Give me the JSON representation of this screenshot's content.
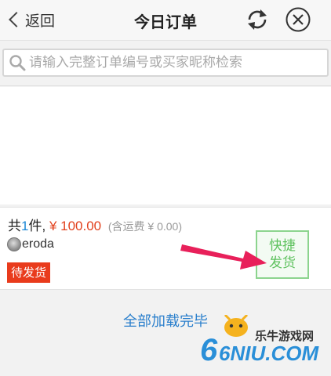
{
  "header": {
    "back_label": "返回",
    "title": "今日订单"
  },
  "icons": {
    "back": "chevron-left-icon",
    "refresh": "refresh-icon",
    "close": "close-circle-icon",
    "search": "search-icon",
    "next": "chevron-right-circle-icon"
  },
  "search": {
    "placeholder": "请输入完整订单编号或买家昵称检索",
    "value": ""
  },
  "order": {
    "prefix": "共",
    "quantity": "1",
    "unit": "件,",
    "price": "¥ 100.00",
    "shipping": "(含运费 ¥ 0.00)",
    "buyer": "eroda",
    "status": "待发货",
    "ship_button_line1": "快捷",
    "ship_button_line2": "发货"
  },
  "footer": {
    "loaded_text": "全部加载完毕"
  },
  "watermark": {
    "text": "乐牛游戏网",
    "logo": "6NIU.COM"
  },
  "colors": {
    "price": "#e2411d",
    "quantity": "#1b87d6",
    "status_bg": "#e93b1c",
    "ship_button": "#5fc25f",
    "annotation_arrow": "#e8205a",
    "loaded_text": "#2a7fcc"
  }
}
